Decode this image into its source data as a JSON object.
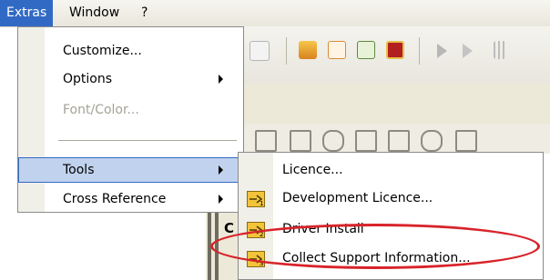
{
  "menubar": {
    "items": [
      "Extras",
      "Window",
      "?"
    ]
  },
  "extras_menu": {
    "items": [
      {
        "label": "Customize...",
        "submenu": false,
        "disabled": false
      },
      {
        "label": "Options",
        "submenu": true,
        "disabled": false
      },
      {
        "label": "Font/Color...",
        "submenu": false,
        "disabled": true
      },
      {
        "label": "Tools",
        "submenu": true,
        "disabled": false,
        "highlighted": true
      },
      {
        "label": "Cross Reference",
        "submenu": true,
        "disabled": false
      }
    ]
  },
  "tools_menu": {
    "items": [
      {
        "label": "Licence...",
        "icon": "none"
      },
      {
        "label": "Development Licence...",
        "icon": "key-1-icon"
      },
      {
        "label": "Driver Install",
        "icon": "key-2-icon"
      },
      {
        "label": "Collect Support Information...",
        "icon": "key-3-icon"
      }
    ]
  },
  "background": {
    "label_c": "C"
  },
  "colors": {
    "highlight": "#316ac5",
    "annotation": "#d8232a",
    "icon_yellow": "#f3c43a"
  }
}
